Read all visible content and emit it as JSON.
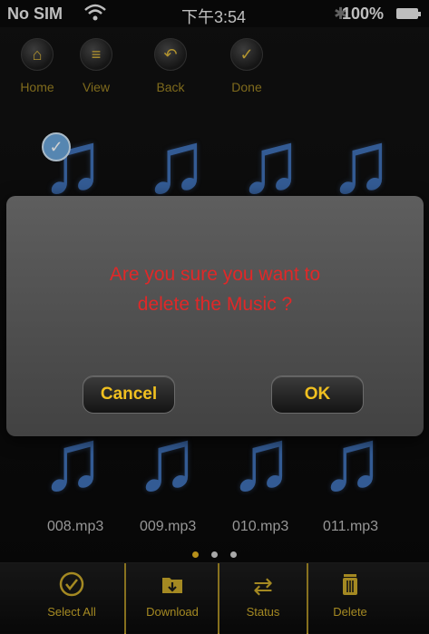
{
  "status_bar": {
    "carrier": "No SIM",
    "time": "下午3:54",
    "battery": "100%"
  },
  "toolbar": {
    "items": [
      {
        "label": "Home",
        "icon": "home-icon"
      },
      {
        "label": "View",
        "icon": "list-icon"
      },
      {
        "label": "Back",
        "icon": "back-arrow-icon"
      },
      {
        "label": "Done",
        "icon": "checkmark-icon"
      }
    ]
  },
  "files": {
    "visible_labels": [
      "008.mp3",
      "009.mp3",
      "010.mp3",
      "011.mp3"
    ]
  },
  "pager": {
    "pages": 3,
    "active": 1
  },
  "dialog": {
    "message_line1": "Are you sure you want to",
    "message_line2": "delete the Music ?",
    "cancel": "Cancel",
    "ok": "OK"
  },
  "tabbar": {
    "items": [
      {
        "label": "Select All",
        "icon": "check-circle-icon"
      },
      {
        "label": "Download",
        "icon": "download-folder-icon"
      },
      {
        "label": "Status",
        "icon": "transfer-arrows-icon"
      },
      {
        "label": "Delete",
        "icon": "trash-icon"
      }
    ]
  },
  "colors": {
    "accent": "#c9a82a",
    "alert_text": "#e02828",
    "note": "#3f6fb5"
  }
}
